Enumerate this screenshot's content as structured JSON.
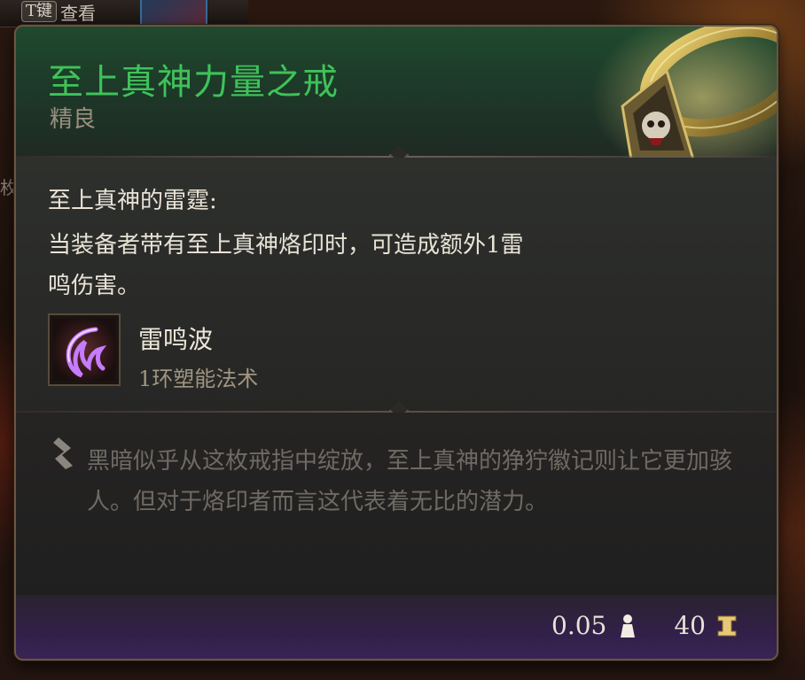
{
  "top_bar": {
    "key_label": "T键",
    "action_label": "查看"
  },
  "left_edge_text": "枚",
  "item": {
    "name": "至上真神力量之戒",
    "rarity": "精良",
    "effect_title": "至上真神的雷霆:",
    "effect_description": "当装备者带有至上真神烙印时，可造成额外1雷鸣伤害。",
    "spell": {
      "name": "雷鸣波",
      "level": "1环塑能法术",
      "icon": "thunderwave-icon"
    },
    "lore": "黑暗似乎从这枚戒指中绽放，至上真神的狰狞徽记则让它更加骇人。但对于烙印者而言这代表着无比的潜力。",
    "weight": "0.05",
    "value": "40"
  },
  "colors": {
    "name_green": "#3fc25a",
    "rarity_gray": "#9a9080",
    "lore_gray": "#6f6a64",
    "footer_purple": "#3a2456"
  },
  "icons": {
    "ring": "ring-icon",
    "quill": "quill-icon",
    "weight": "weight-icon",
    "value": "gold-icon"
  }
}
